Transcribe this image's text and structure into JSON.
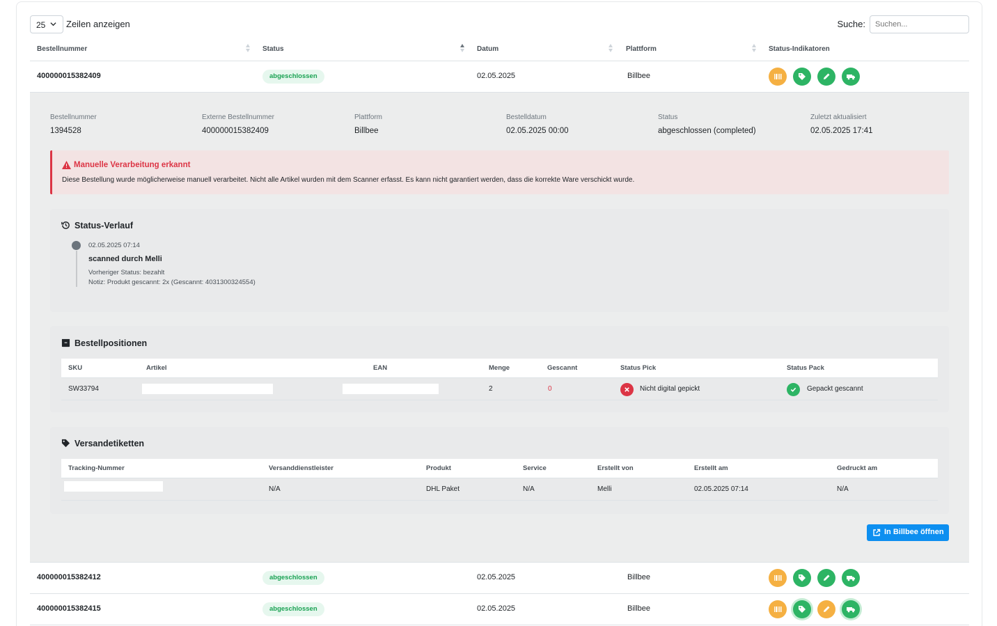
{
  "controls": {
    "length_value": "25",
    "length_label": "Zeilen anzeigen",
    "search_label": "Suche:",
    "search_placeholder": "Suchen..."
  },
  "columns": [
    "Bestellnummer",
    "Status",
    "Datum",
    "Plattform",
    "Status-Indikatoren"
  ],
  "rows": [
    {
      "order": "400000015382409",
      "status": "abgeschlossen",
      "date": "02.05.2025",
      "platform": "Billbee"
    },
    {
      "order": "400000015382412",
      "status": "abgeschlossen",
      "date": "02.05.2025",
      "platform": "Billbee"
    },
    {
      "order": "400000015382415",
      "status": "abgeschlossen",
      "date": "02.05.2025",
      "platform": "Billbee"
    }
  ],
  "indicator_icons": [
    "barcode-icon",
    "tag-icon",
    "pencil-icon",
    "truck-icon"
  ],
  "details": {
    "meta": [
      {
        "label": "Bestellnummer",
        "value": "1394528"
      },
      {
        "label": "Externe Bestellnummer",
        "value": "400000015382409"
      },
      {
        "label": "Plattform",
        "value": "Billbee"
      },
      {
        "label": "Bestelldatum",
        "value": "02.05.2025 00:00"
      },
      {
        "label": "Status",
        "value": "abgeschlossen (completed)"
      },
      {
        "label": "Zuletzt aktualisiert",
        "value": "02.05.2025 17:41"
      }
    ],
    "alert": {
      "title": "Manuelle Verarbeitung erkannt",
      "text": "Diese Bestellung wurde möglicherweise manuell verarbeitet. Nicht alle Artikel wurden mit dem Scanner erfasst. Es kann nicht garantiert werden, dass die korrekte Ware verschickt wurde."
    },
    "history": {
      "title": "Status-Verlauf",
      "entry": {
        "time": "02.05.2025 07:14",
        "title": "scanned durch Melli",
        "previous": "Vorheriger Status: bezahlt",
        "note": "Notiz: Produkt gescannt: 2x (Gescannt: 4031300324554)"
      }
    },
    "positions": {
      "title": "Bestellpositionen",
      "headers": [
        "SKU",
        "Artikel",
        "EAN",
        "Menge",
        "Gescannt",
        "Status Pick",
        "Status Pack"
      ],
      "row": {
        "sku": "SW33794",
        "menge": "2",
        "gescannt": "0",
        "status_pick": "Nicht digital gepickt",
        "status_pack": "Gepackt gescannt"
      }
    },
    "labels": {
      "title": "Versandetiketten",
      "headers": [
        "Tracking-Nummer",
        "Versanddienstleister",
        "Produkt",
        "Service",
        "Erstellt von",
        "Erstellt am",
        "Gedruckt am"
      ],
      "row": {
        "carrier": "N/A",
        "product": "DHL Paket",
        "service": "N/A",
        "created_by": "Melli",
        "created_at": "02.05.2025 07:14",
        "printed_at": "N/A"
      }
    },
    "open_button": "In Billbee öffnen"
  },
  "colors": {
    "badge_green": "#1aa253",
    "indicator_orange": "#f5b042",
    "indicator_green": "#2db464",
    "alert_red": "#dc3545",
    "button_blue": "#0d8ff0"
  }
}
